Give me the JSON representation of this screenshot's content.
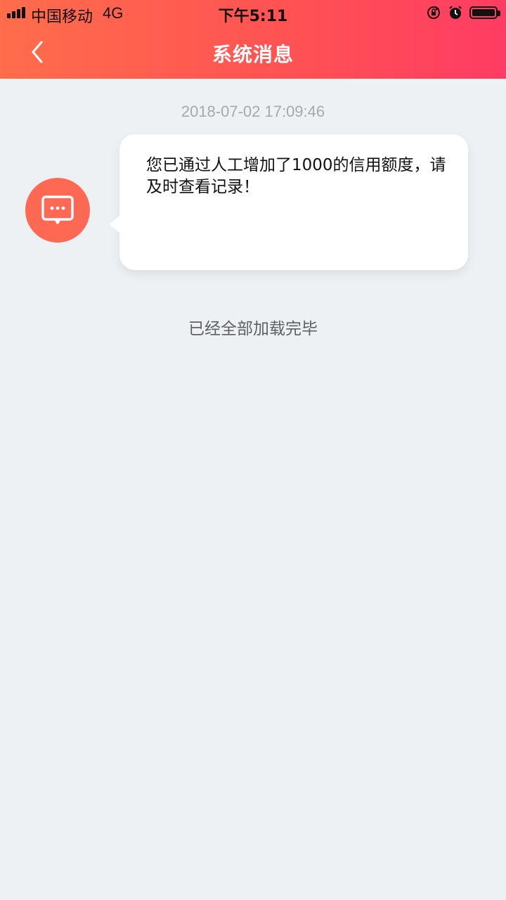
{
  "status_bar": {
    "carrier": "中国移动",
    "network": "4G",
    "time": "下午5:11",
    "icons": [
      "signal-icon",
      "rotation-lock-icon",
      "alarm-icon",
      "battery-icon"
    ]
  },
  "header": {
    "title": "系统消息",
    "back_icon": "back-arrow-icon",
    "gradient_colors": [
      "#ff6d4b",
      "#ff5353",
      "#ff3c63"
    ]
  },
  "messages": [
    {
      "timestamp": "2018-07-02 17:09:46",
      "avatar_icon": "message-icon",
      "avatar_color": "#ff6852",
      "text": "您已通过人工增加了1000的信用额度，请及时查看记录！"
    }
  ],
  "footer_status": "已经全部加载完毕"
}
